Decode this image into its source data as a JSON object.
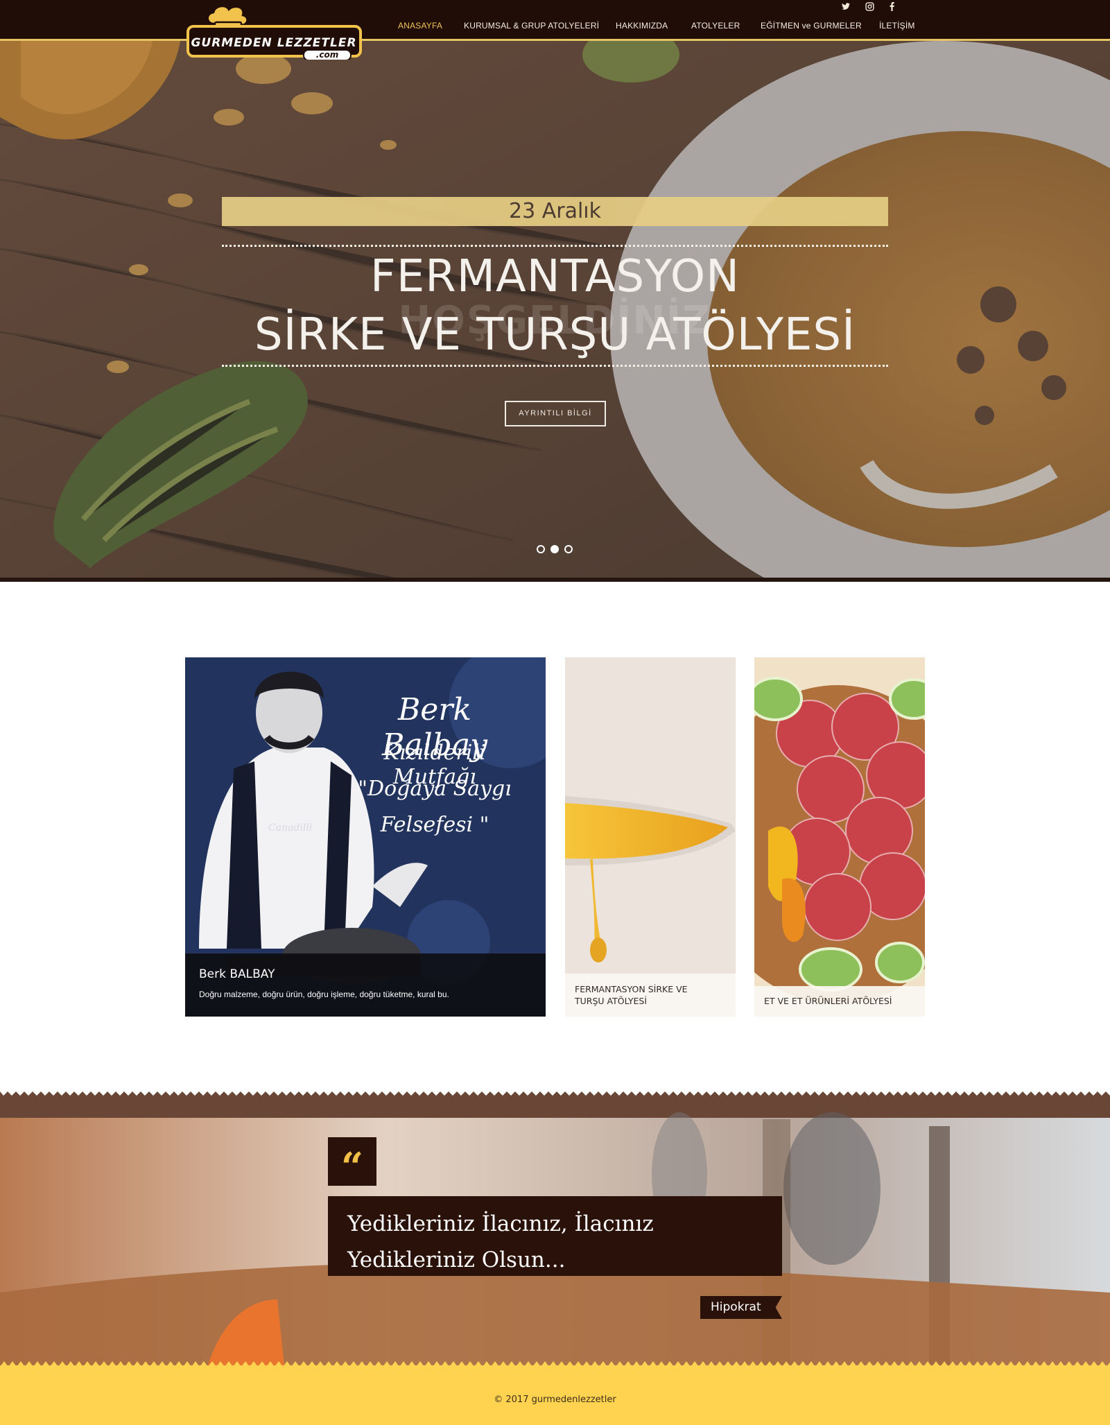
{
  "header": {
    "brand_line1": "GURMEDEN LEZZETLER",
    "brand_line2": ".com",
    "social": [
      {
        "icon": "twitter-icon",
        "glyph": "🐦"
      },
      {
        "icon": "instagram-icon",
        "glyph": "◘"
      },
      {
        "icon": "facebook-icon",
        "glyph": "f"
      }
    ],
    "nav": [
      {
        "label": "ANASAYFA",
        "active": true
      },
      {
        "label": "KURUMSAL & GRUP ATOLYELERİ",
        "active": false
      },
      {
        "label": "HAKKIMIZDA",
        "active": false
      },
      {
        "label": "ATOLYELER",
        "active": false
      },
      {
        "label": "EĞİTMEN ve GURMELER",
        "active": false
      },
      {
        "label": "İLETİŞİM",
        "active": false
      }
    ]
  },
  "hero": {
    "date": "23 Aralık",
    "title_line1": "FERMANTASYON",
    "title_line2": "SİRKE VE TURŞU ATÖLYESİ",
    "ghost_text": "HOŞGELDİNİZ",
    "button": "AYRINTILI BİLGİ",
    "slides": 3,
    "active_slide": 2
  },
  "cards": {
    "featured": {
      "script_lines": [
        "Berk Balbay",
        "Kızılderili Mutfağı",
        "\"Doğaya Saygı",
        "Felsefesi \""
      ],
      "apron_text": "Canadilli",
      "name": "Berk BALBAY",
      "description": "Doğru malzeme, doğru ürün, doğru işleme, doğru tüketme, kural bu."
    },
    "oil": {
      "caption_line1": "FERMANTASYON SİRKE VE",
      "caption_line2": "TURŞU ATÖLYESİ"
    },
    "meat": {
      "caption": "ET VE ET ÜRÜNLERİ ATÖLYESİ"
    }
  },
  "quote": {
    "mark": "“",
    "text": "Yedikleriniz İlacınız, İlacınız Yedikleriniz Olsun...",
    "author": "Hipokrat"
  },
  "footer": {
    "copyright": "© 2017 gurmedenlezzetler"
  },
  "colors": {
    "header_bg": "#200d07",
    "accent_gold": "#e7c463",
    "active_nav": "#f0c45a",
    "quote_bg": "#2a120a",
    "footer_bg": "#ffd24f"
  }
}
